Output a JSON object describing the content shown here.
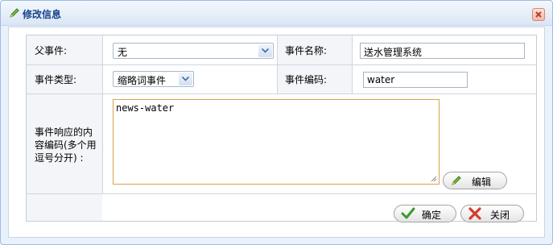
{
  "dialog": {
    "title": "修改信息",
    "icons": {
      "title": "pencil-icon",
      "close": "close-icon"
    }
  },
  "form": {
    "parent_event_label": "父事件:",
    "parent_event_value": "无",
    "event_name_label": "事件名称:",
    "event_name_value": "送水管理系统",
    "event_type_label": "事件类型:",
    "event_type_value": "缩略词事件",
    "event_code_label": "事件编码:",
    "event_code_value": "water",
    "response_codes_label_lines": [
      "事件响应的内",
      "容编码(多个用",
      "逗号分开) :"
    ],
    "response_codes_value": "news-water",
    "edit_button_label": "编辑"
  },
  "footer": {
    "confirm_label": "确定",
    "close_label": "关闭"
  },
  "colors": {
    "title_text": "#15428b",
    "border": "#99bbe8",
    "textarea_focus": "#d7a24b",
    "check_green": "#3c9a2f",
    "close_red": "#d93a2b"
  }
}
